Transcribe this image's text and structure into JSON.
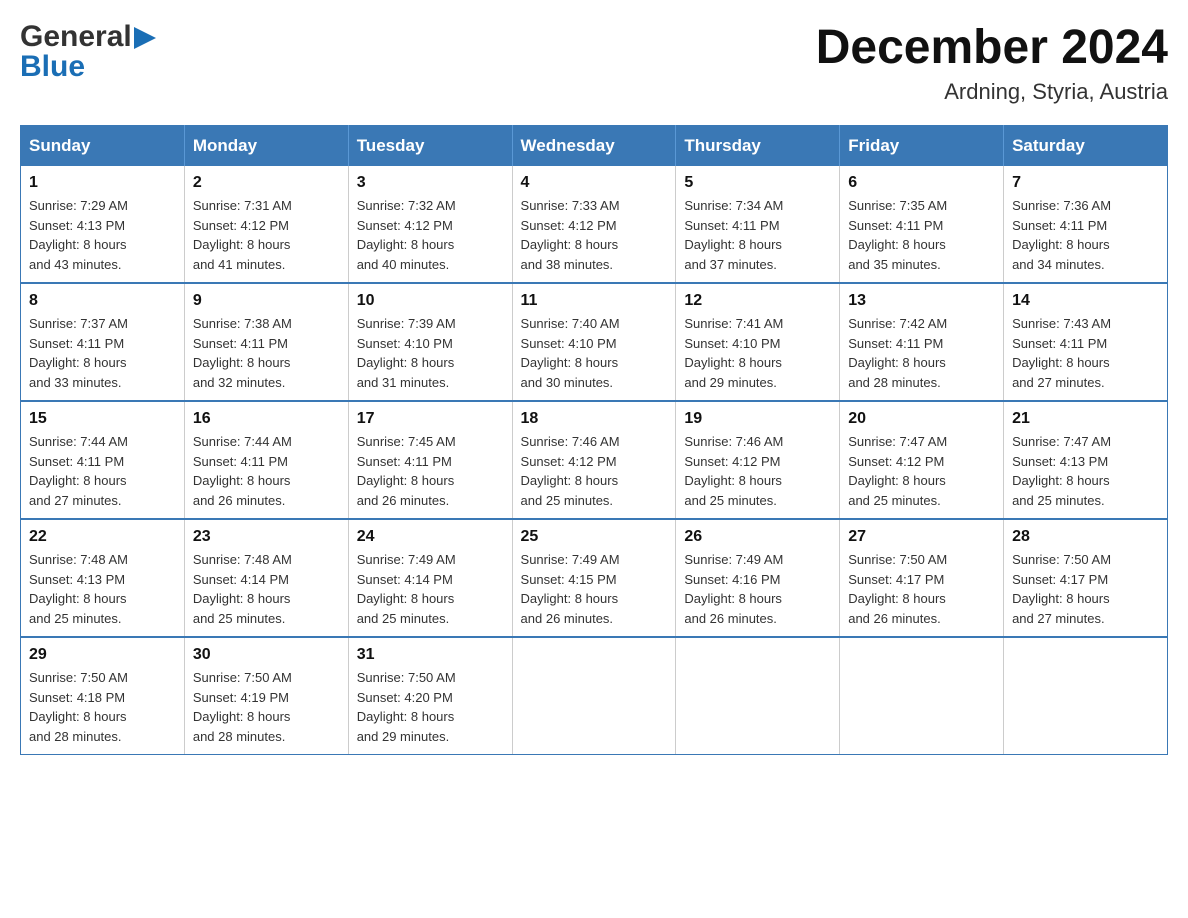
{
  "header": {
    "logo_line1": "General",
    "logo_line2": "Blue",
    "month_title": "December 2024",
    "location": "Ardning, Styria, Austria"
  },
  "days_of_week": [
    "Sunday",
    "Monday",
    "Tuesday",
    "Wednesday",
    "Thursday",
    "Friday",
    "Saturday"
  ],
  "weeks": [
    [
      {
        "day": "1",
        "sunrise": "7:29 AM",
        "sunset": "4:13 PM",
        "daylight": "8 hours and 43 minutes."
      },
      {
        "day": "2",
        "sunrise": "7:31 AM",
        "sunset": "4:12 PM",
        "daylight": "8 hours and 41 minutes."
      },
      {
        "day": "3",
        "sunrise": "7:32 AM",
        "sunset": "4:12 PM",
        "daylight": "8 hours and 40 minutes."
      },
      {
        "day": "4",
        "sunrise": "7:33 AM",
        "sunset": "4:12 PM",
        "daylight": "8 hours and 38 minutes."
      },
      {
        "day": "5",
        "sunrise": "7:34 AM",
        "sunset": "4:11 PM",
        "daylight": "8 hours and 37 minutes."
      },
      {
        "day": "6",
        "sunrise": "7:35 AM",
        "sunset": "4:11 PM",
        "daylight": "8 hours and 35 minutes."
      },
      {
        "day": "7",
        "sunrise": "7:36 AM",
        "sunset": "4:11 PM",
        "daylight": "8 hours and 34 minutes."
      }
    ],
    [
      {
        "day": "8",
        "sunrise": "7:37 AM",
        "sunset": "4:11 PM",
        "daylight": "8 hours and 33 minutes."
      },
      {
        "day": "9",
        "sunrise": "7:38 AM",
        "sunset": "4:11 PM",
        "daylight": "8 hours and 32 minutes."
      },
      {
        "day": "10",
        "sunrise": "7:39 AM",
        "sunset": "4:10 PM",
        "daylight": "8 hours and 31 minutes."
      },
      {
        "day": "11",
        "sunrise": "7:40 AM",
        "sunset": "4:10 PM",
        "daylight": "8 hours and 30 minutes."
      },
      {
        "day": "12",
        "sunrise": "7:41 AM",
        "sunset": "4:10 PM",
        "daylight": "8 hours and 29 minutes."
      },
      {
        "day": "13",
        "sunrise": "7:42 AM",
        "sunset": "4:11 PM",
        "daylight": "8 hours and 28 minutes."
      },
      {
        "day": "14",
        "sunrise": "7:43 AM",
        "sunset": "4:11 PM",
        "daylight": "8 hours and 27 minutes."
      }
    ],
    [
      {
        "day": "15",
        "sunrise": "7:44 AM",
        "sunset": "4:11 PM",
        "daylight": "8 hours and 27 minutes."
      },
      {
        "day": "16",
        "sunrise": "7:44 AM",
        "sunset": "4:11 PM",
        "daylight": "8 hours and 26 minutes."
      },
      {
        "day": "17",
        "sunrise": "7:45 AM",
        "sunset": "4:11 PM",
        "daylight": "8 hours and 26 minutes."
      },
      {
        "day": "18",
        "sunrise": "7:46 AM",
        "sunset": "4:12 PM",
        "daylight": "8 hours and 25 minutes."
      },
      {
        "day": "19",
        "sunrise": "7:46 AM",
        "sunset": "4:12 PM",
        "daylight": "8 hours and 25 minutes."
      },
      {
        "day": "20",
        "sunrise": "7:47 AM",
        "sunset": "4:12 PM",
        "daylight": "8 hours and 25 minutes."
      },
      {
        "day": "21",
        "sunrise": "7:47 AM",
        "sunset": "4:13 PM",
        "daylight": "8 hours and 25 minutes."
      }
    ],
    [
      {
        "day": "22",
        "sunrise": "7:48 AM",
        "sunset": "4:13 PM",
        "daylight": "8 hours and 25 minutes."
      },
      {
        "day": "23",
        "sunrise": "7:48 AM",
        "sunset": "4:14 PM",
        "daylight": "8 hours and 25 minutes."
      },
      {
        "day": "24",
        "sunrise": "7:49 AM",
        "sunset": "4:14 PM",
        "daylight": "8 hours and 25 minutes."
      },
      {
        "day": "25",
        "sunrise": "7:49 AM",
        "sunset": "4:15 PM",
        "daylight": "8 hours and 26 minutes."
      },
      {
        "day": "26",
        "sunrise": "7:49 AM",
        "sunset": "4:16 PM",
        "daylight": "8 hours and 26 minutes."
      },
      {
        "day": "27",
        "sunrise": "7:50 AM",
        "sunset": "4:17 PM",
        "daylight": "8 hours and 26 minutes."
      },
      {
        "day": "28",
        "sunrise": "7:50 AM",
        "sunset": "4:17 PM",
        "daylight": "8 hours and 27 minutes."
      }
    ],
    [
      {
        "day": "29",
        "sunrise": "7:50 AM",
        "sunset": "4:18 PM",
        "daylight": "8 hours and 28 minutes."
      },
      {
        "day": "30",
        "sunrise": "7:50 AM",
        "sunset": "4:19 PM",
        "daylight": "8 hours and 28 minutes."
      },
      {
        "day": "31",
        "sunrise": "7:50 AM",
        "sunset": "4:20 PM",
        "daylight": "8 hours and 29 minutes."
      },
      null,
      null,
      null,
      null
    ]
  ],
  "labels": {
    "sunrise_prefix": "Sunrise: ",
    "sunset_prefix": "Sunset: ",
    "daylight_prefix": "Daylight: "
  }
}
